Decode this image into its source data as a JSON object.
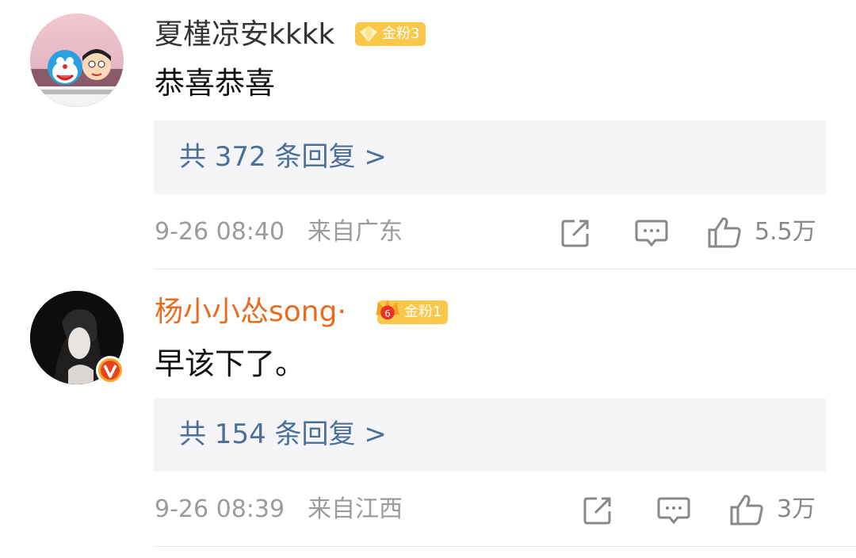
{
  "comments": [
    {
      "username": "夏槿凉安kkkk",
      "username_color": "#333333",
      "badge": "金粉3",
      "text": "恭喜恭喜",
      "replies": "共 372 条回复 >",
      "time": "9-26 08:40",
      "location": "来自广东",
      "likes": "5.5万",
      "avatar_icon": "doraemon-nobita-avatar"
    },
    {
      "username": "杨小小怂song·",
      "username_color": "#e86b1f",
      "badge": "金粉1",
      "text": "早该下了。",
      "replies": "共 154 条回复 >",
      "time": "9-26 08:39",
      "location": "来自江西",
      "likes": "3万",
      "avatar_icon": "woman-portrait-avatar",
      "verified_icon": "verified-v-icon"
    }
  ],
  "colors": {
    "link_blue": "#4a6f9a",
    "meta_gray": "#9b9b9b",
    "badge_gold": "#f9c84a",
    "reply_bg": "#f5f5f7"
  }
}
